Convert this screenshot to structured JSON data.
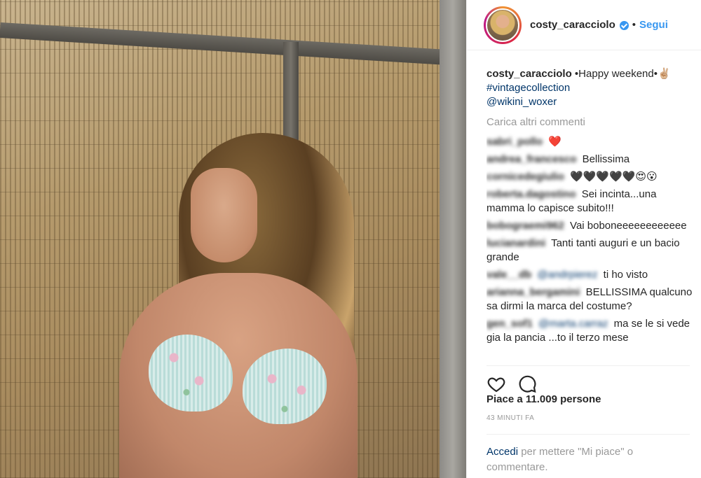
{
  "post": {
    "username": "costy_caracciolo",
    "dot": "•",
    "follow_label": "Segui",
    "caption": {
      "username": "costy_caracciolo",
      "text": "•Happy weekend•✌🏼",
      "hashtag": "#vintagecollection",
      "mention": "@wikini_woxer"
    },
    "load_more": "Carica altri commenti",
    "comments": [
      {
        "user": "sabri_pollo",
        "mention": "",
        "text": "❤️"
      },
      {
        "user": "andrea_francesco",
        "mention": "",
        "text": "Bellissima"
      },
      {
        "user": "cornicedegiulio",
        "mention": "",
        "text": "🖤🖤🖤🖤🖤😍😮"
      },
      {
        "user": "roberta.dagostino",
        "mention": "",
        "text": "Sei incinta...una mamma lo capisce subito!!!"
      },
      {
        "user": "bobograemi962",
        "mention": "",
        "text": "Vai boboneeeeeeeeeeee"
      },
      {
        "user": "lucianardini",
        "mention": "",
        "text": "Tanti tanti auguri e un bacio grande"
      },
      {
        "user": "vale__db",
        "mention": "@andrpierez",
        "text": "ti ho visto"
      },
      {
        "user": "arianna_bergamini",
        "mention": "",
        "text": "BELLISSIMA qualcuno sa dirmi la marca del costume?"
      },
      {
        "user": "gen_sof1",
        "mention": "@marta.carraz",
        "text": "ma se le si vede gia la pancia ...to il terzo mese"
      }
    ],
    "likes": "Piace a 11.009 persone",
    "timestamp": "43 MINUTI FA",
    "login": {
      "link": "Accedi",
      "rest": " per mettere \"Mi piace\" o commentare."
    }
  },
  "icons": {
    "like": "heart-outline-icon",
    "comment": "speech-bubble-icon",
    "verified": "verified-badge-icon"
  },
  "colors": {
    "link": "#003569",
    "follow": "#3897f0",
    "muted": "#999999",
    "text": "#262626"
  }
}
